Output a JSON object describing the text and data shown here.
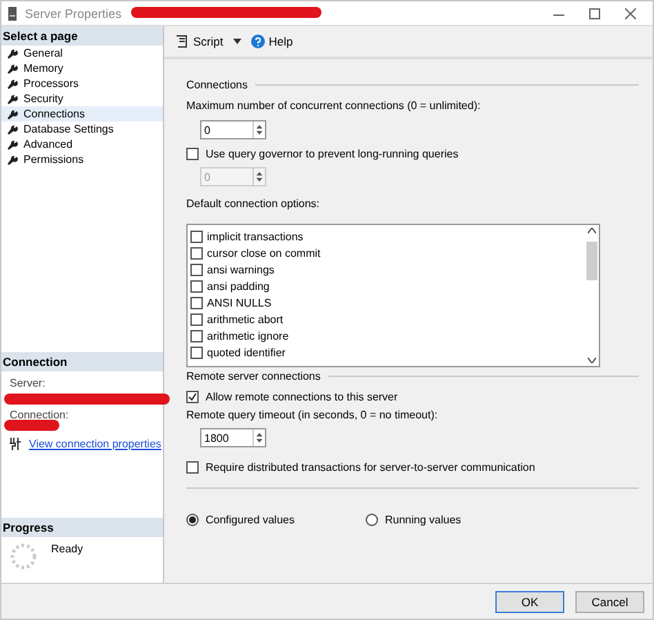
{
  "window": {
    "title": "Server Properties"
  },
  "toolbar": {
    "script": "Script",
    "help": "Help"
  },
  "sidebar": {
    "header": "Select a page",
    "items": [
      {
        "label": "General",
        "selected": false
      },
      {
        "label": "Memory",
        "selected": false
      },
      {
        "label": "Processors",
        "selected": false
      },
      {
        "label": "Security",
        "selected": false
      },
      {
        "label": "Connections",
        "selected": true
      },
      {
        "label": "Database Settings",
        "selected": false
      },
      {
        "label": "Advanced",
        "selected": false
      },
      {
        "label": "Permissions",
        "selected": false
      }
    ]
  },
  "connection": {
    "header": "Connection",
    "server_label": "Server:",
    "connection_label": "Connection:",
    "link": "View connection properties"
  },
  "progress": {
    "header": "Progress",
    "status": "Ready"
  },
  "connections": {
    "title": "Connections",
    "max_label": "Maximum number of concurrent connections (0 = unlimited):",
    "max_value": "0",
    "governor": {
      "label": "Use query governor to prevent long-running queries",
      "checked": false
    },
    "governor_value": {
      "value": "0",
      "disabled": true
    },
    "options_label": "Default connection options:",
    "options": [
      {
        "label": "implicit transactions",
        "checked": false
      },
      {
        "label": "cursor close on commit",
        "checked": false
      },
      {
        "label": "ansi warnings",
        "checked": false
      },
      {
        "label": "ansi padding",
        "checked": false
      },
      {
        "label": "ANSI NULLS",
        "checked": false
      },
      {
        "label": "arithmetic abort",
        "checked": false
      },
      {
        "label": "arithmetic ignore",
        "checked": false
      },
      {
        "label": "quoted identifier",
        "checked": false
      }
    ]
  },
  "remote": {
    "title": "Remote server connections",
    "allow": {
      "label": "Allow remote connections to this server",
      "checked": true
    },
    "timeout_label": "Remote query timeout (in seconds, 0 = no timeout):",
    "timeout_value": "1800",
    "distributed": {
      "label": "Require distributed transactions for server-to-server communication",
      "checked": false
    }
  },
  "values": [
    {
      "label": "Configured values",
      "selected": true
    },
    {
      "label": "Running values",
      "selected": false
    }
  ],
  "buttons": [
    {
      "label": "OK",
      "default": true
    },
    {
      "label": "Cancel",
      "default": false
    }
  ]
}
